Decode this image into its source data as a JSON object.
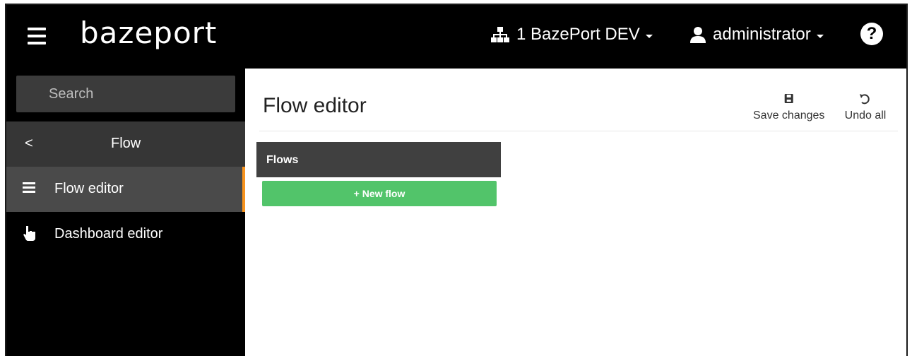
{
  "header": {
    "logo_text": "bazeport",
    "org_label": "1 BazePort DEV",
    "user_label": "administrator",
    "help_label": "?"
  },
  "sidebar": {
    "search_placeholder": "Search",
    "section_title": "Flow",
    "back_label": "<",
    "items": [
      {
        "label": "Flow editor",
        "icon": "list-icon",
        "active": true
      },
      {
        "label": "Dashboard editor",
        "icon": "pointer-hand-icon",
        "active": false
      }
    ]
  },
  "main": {
    "title": "Flow editor",
    "save_label": "Save changes",
    "undo_label": "Undo all",
    "flows_header": "Flows",
    "new_flow_label": "New flow"
  },
  "colors": {
    "accent": "#f7931e",
    "new_flow_green": "#52c46a",
    "topbar": "#000000",
    "sidebar_active": "#4a4a4a"
  }
}
